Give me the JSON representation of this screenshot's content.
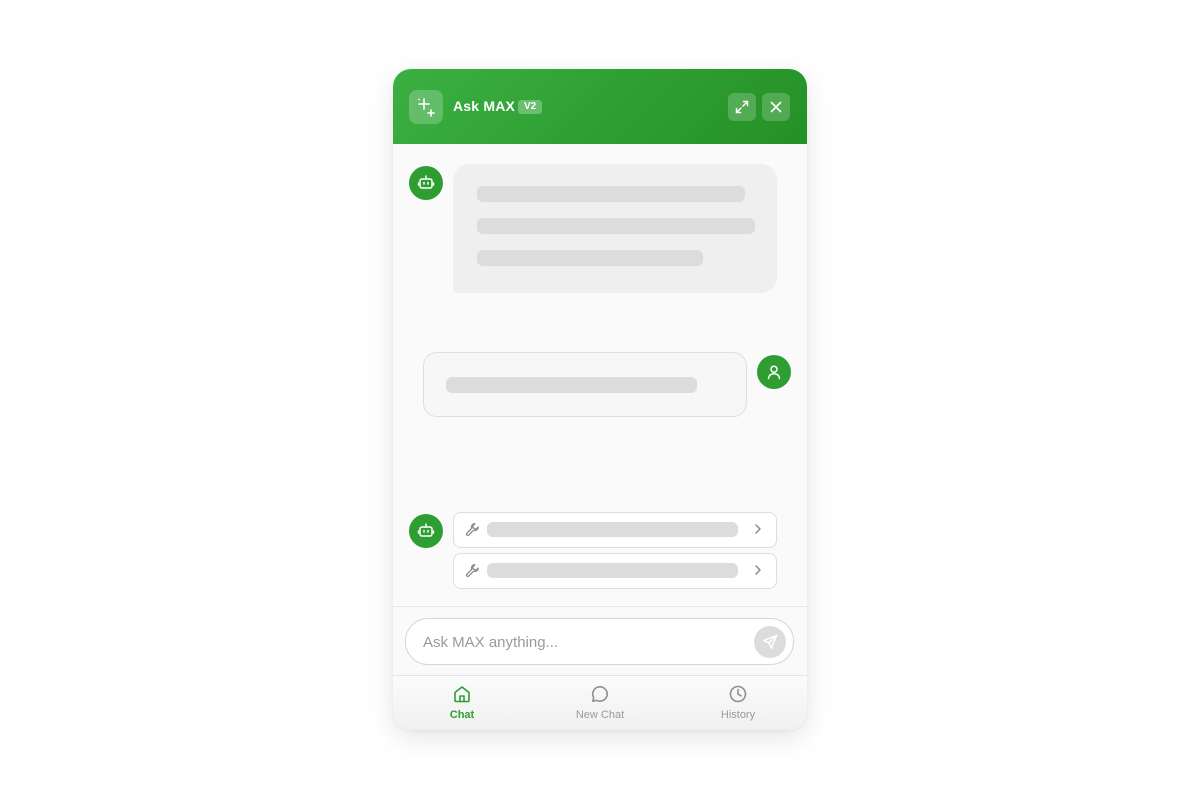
{
  "header": {
    "title": "Ask MAX",
    "version_badge": "V2",
    "logo_icon": "sparkle-icon",
    "expand_icon": "expand-icon",
    "close_icon": "close-icon"
  },
  "colors": {
    "brand_green": "#2e9e33",
    "skeleton": "#dcdcdc",
    "bubble_bg": "#efefef"
  },
  "messages": [
    {
      "role": "assistant",
      "avatar_icon": "robot-icon",
      "content": "loading-skeleton"
    },
    {
      "role": "user",
      "avatar_icon": "user-icon",
      "content": "loading-skeleton"
    },
    {
      "role": "assistant",
      "avatar_icon": "robot-icon",
      "tool_calls": [
        {
          "icon": "wrench-icon",
          "chevron": "chevron-right-icon"
        },
        {
          "icon": "wrench-icon",
          "chevron": "chevron-right-icon"
        }
      ]
    }
  ],
  "composer": {
    "placeholder": "Ask MAX anything...",
    "value": "",
    "send_icon": "send-icon"
  },
  "nav": {
    "items": [
      {
        "label": "Chat",
        "icon": "home-icon",
        "active": true
      },
      {
        "label": "New Chat",
        "icon": "chat-bubble-icon",
        "active": false
      },
      {
        "label": "History",
        "icon": "clock-icon",
        "active": false
      }
    ]
  }
}
